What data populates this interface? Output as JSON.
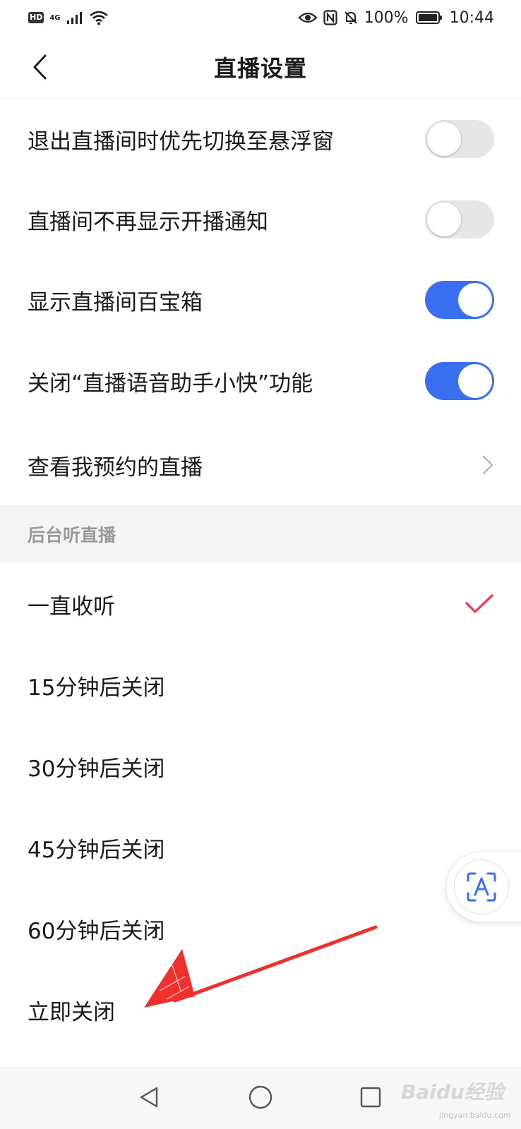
{
  "status_bar": {
    "hd": "HD",
    "network": "4G",
    "battery_percent": "100%",
    "time": "10:44"
  },
  "header": {
    "title": "直播设置"
  },
  "settings": [
    {
      "label": "退出直播间时优先切换至悬浮窗",
      "type": "toggle",
      "on": false
    },
    {
      "label": "直播间不再显示开播通知",
      "type": "toggle",
      "on": false
    },
    {
      "label": "显示直播间百宝箱",
      "type": "toggle",
      "on": true
    },
    {
      "label": "关闭“直播语音助手小快”功能",
      "type": "toggle",
      "on": true
    },
    {
      "label": "查看我预约的直播",
      "type": "link"
    }
  ],
  "background_section": {
    "title": "后台听直播",
    "selected_index": 0,
    "options": [
      {
        "label": "一直收听"
      },
      {
        "label": "15分钟后关闭"
      },
      {
        "label": "30分钟后关闭"
      },
      {
        "label": "45分钟后关闭"
      },
      {
        "label": "60分钟后关闭"
      },
      {
        "label": "立即关闭"
      }
    ]
  },
  "colors": {
    "toggle_on": "#3a6ff2",
    "toggle_off": "#e6e6e6",
    "checkmark": "#e8435f",
    "annotation_arrow": "#f0302c"
  },
  "watermark": {
    "brand": "Baidu经验",
    "url": "jingyan.baidu.com"
  }
}
